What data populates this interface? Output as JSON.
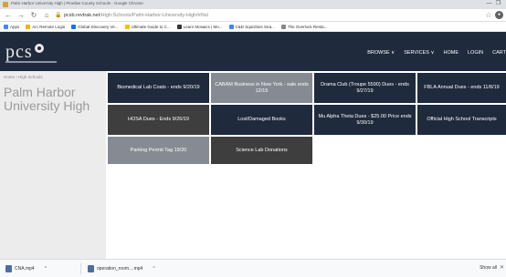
{
  "window": {
    "title": "Palm Harbor University High | Pinellas County Schools - Google Chrome",
    "controls": [
      "—",
      "❐"
    ]
  },
  "address": {
    "host": "pcsb.revtrak.net",
    "path": "/High-Schools/Palm-Harbor-University-High/#/list"
  },
  "bookmarks": [
    {
      "label": "Apps",
      "color": "#4285f4"
    },
    {
      "label": "Arc Remote Login",
      "color": "#f4b400"
    },
    {
      "label": "Global Discovery Ve...",
      "color": "#1a73e8"
    },
    {
      "label": "Ultimate Guide to C...",
      "color": "#fbbc04"
    },
    {
      "label": "Learn Mosaics | Mo...",
      "color": "#333333"
    },
    {
      "label": "C&D Squishies Sea...",
      "color": "#4285f4"
    },
    {
      "label": "The Overlock Resta...",
      "color": "#888888"
    }
  ],
  "site": {
    "logo": "pcs",
    "nav": [
      "BROWSE ∨",
      "SERVICES ∨",
      "HOME",
      "LOGIN",
      "CART"
    ]
  },
  "sidebar": {
    "breadcrumb": "Home › High Schools",
    "school": "Palm Harbor University High"
  },
  "tiles": [
    "Biomedical Lab Coats - ends 9/20/19",
    "CABAM Business in New York - sale ends 12/15",
    "Drama Club (Troupe 5590) Dues - ends 9/27/19",
    "FBLA Annual Dues - ends 11/8/19",
    "HOSA Dues - Ends 9/26/19",
    "Lost/Damaged Books",
    "Mu Alpha Theta Dues - $25.00 Price ends 9/30/19",
    "Official High School Transcripts",
    "Parking Permit Tag 19/20",
    "Science Lab Donations"
  ],
  "downloads": {
    "items": [
      "CNA.mp4",
      "operation_room....mp4"
    ],
    "show_all": "Show all"
  },
  "colors": {
    "header": "#1f2a3c",
    "tile_navy": "#1f2a3c",
    "tile_gray": "#868b93",
    "tile_dark": "#3e3e3e",
    "sidebar": "#ececec"
  }
}
